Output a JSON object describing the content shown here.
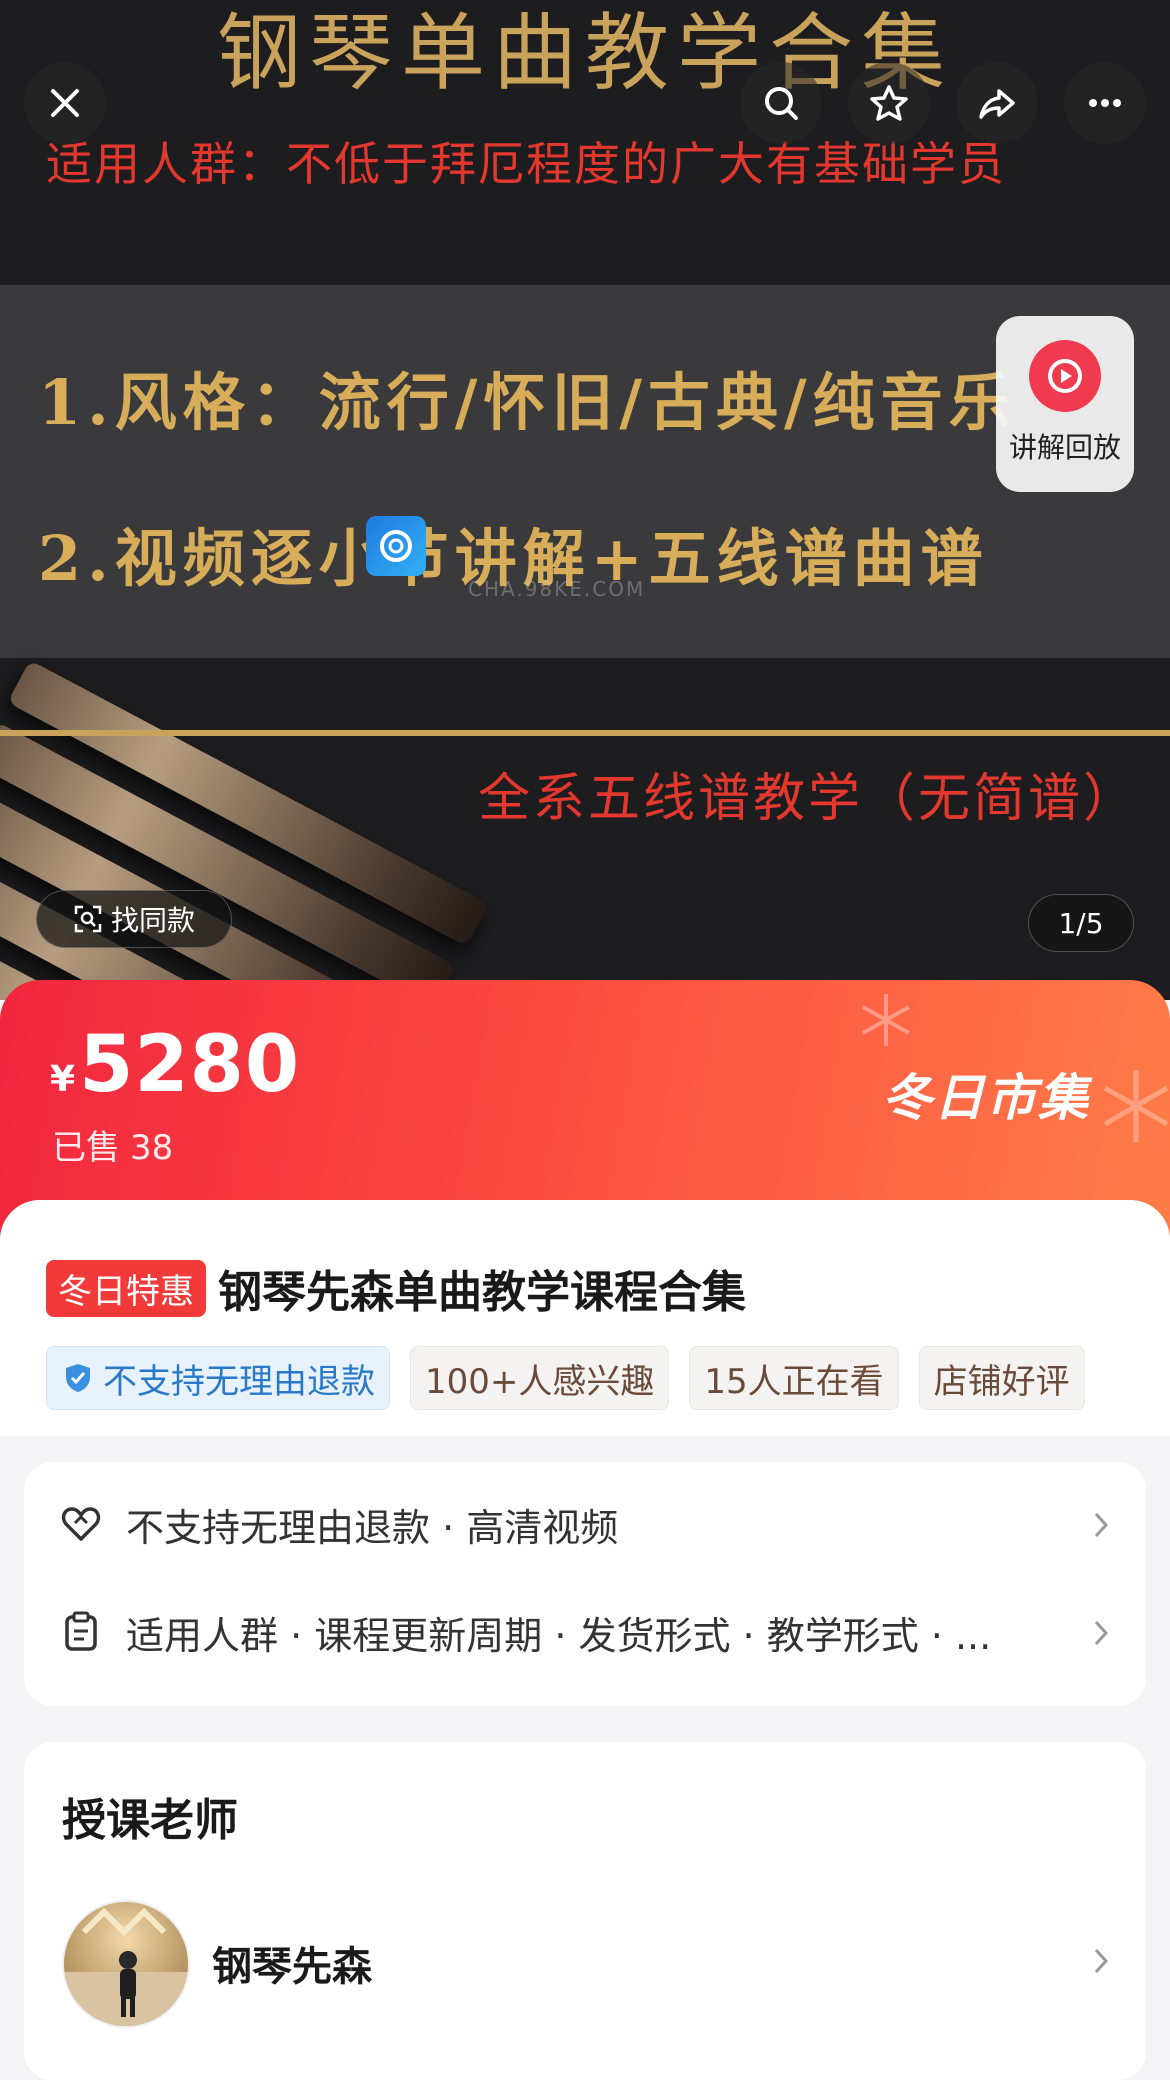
{
  "hero": {
    "title": "钢琴单曲教学合集",
    "audience": "适用人群：不低于拜厄程度的广大有基础学员",
    "feature_1": "1.风格：流行/怀旧/古典/纯音乐",
    "feature_2": "2.视频逐小节讲解+五线谱曲谱",
    "staff_note": "全系五线谱教学（无简谱）",
    "watermark": "CHA.98KE.COM"
  },
  "top_bar": {
    "icons": [
      "close-icon",
      "search-icon",
      "star-icon",
      "share-icon",
      "more-icon"
    ]
  },
  "replay": {
    "label": "讲解回放",
    "icon": "play-icon"
  },
  "find_same": {
    "label": "找同款",
    "icon": "scan-icon"
  },
  "image_counter": "1/5",
  "price": {
    "currency": "¥",
    "amount": "5280",
    "sold_label": "已售",
    "sold_count": "38"
  },
  "promo": {
    "brand": "冬日市集"
  },
  "product": {
    "badge": "冬日特惠",
    "title": "钢琴先森单曲教学课程合集",
    "tags": [
      "不支持无理由退款",
      "100+人感兴趣",
      "15人正在看",
      "店铺好评"
    ]
  },
  "services": [
    {
      "icon": "heart-shield-icon",
      "text": "不支持无理由退款 · 高清视频"
    },
    {
      "icon": "clipboard-icon",
      "text": "适用人群 · 课程更新周期 · 发货形式 · 教学形式 · ..."
    }
  ],
  "teacher": {
    "heading": "授课老师",
    "name": "钢琴先森"
  },
  "colors": {
    "accent_red": "#f2263f",
    "gold": "#c9a25c",
    "promo_orange": "#ff7d49",
    "tag_blue": "#2a79c8"
  }
}
